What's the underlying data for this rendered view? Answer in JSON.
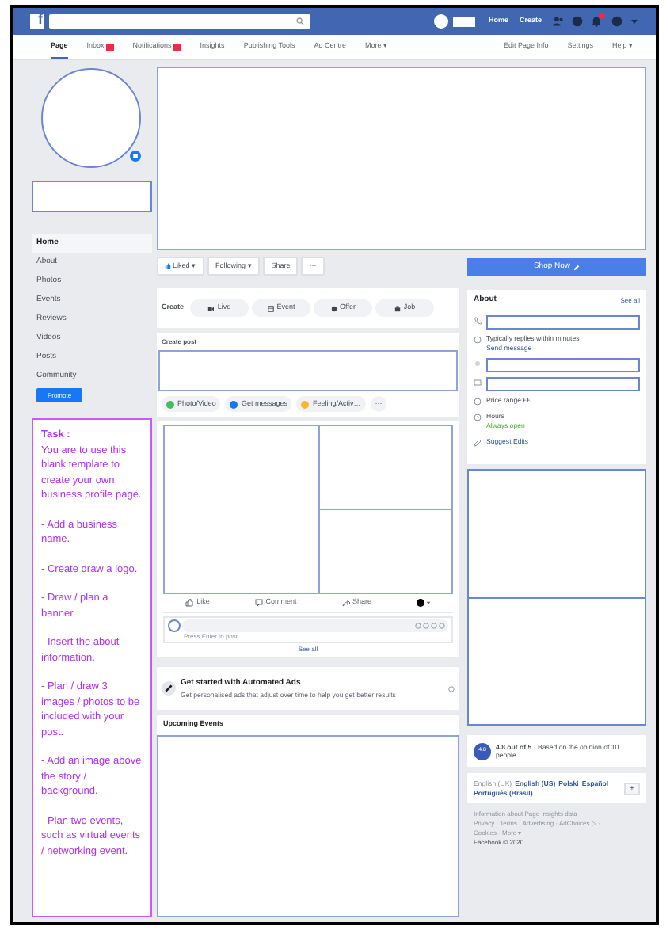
{
  "topbar": {
    "logo": "f",
    "nav": [
      "Home",
      "Create"
    ]
  },
  "tabs": [
    {
      "label": "Page",
      "selected": true,
      "badge": false
    },
    {
      "label": "Inbox",
      "selected": false,
      "badge": true
    },
    {
      "label": "Notifications",
      "selected": false,
      "badge": true
    },
    {
      "label": "Insights",
      "selected": false,
      "badge": false
    },
    {
      "label": "Publishing Tools",
      "selected": false,
      "badge": false
    },
    {
      "label": "Ad Centre",
      "selected": false,
      "badge": false
    },
    {
      "label": "More ▾",
      "selected": false,
      "badge": false
    }
  ],
  "right_tabs": [
    "Edit Page Info",
    "Settings",
    "Help ▾"
  ],
  "sidebar": {
    "items": [
      {
        "label": "Home",
        "selected": true
      },
      {
        "label": "About",
        "selected": false
      },
      {
        "label": "Photos",
        "selected": false
      },
      {
        "label": "Events",
        "selected": false
      },
      {
        "label": "Reviews",
        "selected": false
      },
      {
        "label": "Videos",
        "selected": false
      },
      {
        "label": "Posts",
        "selected": false
      },
      {
        "label": "Community",
        "selected": false
      }
    ],
    "promote": "Promote"
  },
  "task": {
    "title": "Task :",
    "paragraphs": [
      "You are to use this blank template to create your own business profile page.",
      "- Add a business name.",
      "- Create  draw a logo.",
      "- Draw / plan a banner.",
      "- Insert the about information.",
      "- Plan / draw 3 images / photos to be included with your post.",
      "- Add an image above the story / background.",
      "- Plan two events, such as virtual events / networking event."
    ]
  },
  "page_actions": [
    "Liked ▾",
    "Following ▾",
    "Share",
    "···"
  ],
  "shop_button": "Shop Now",
  "create": {
    "label": "Create",
    "buttons": [
      "Live",
      "Event",
      "Offer",
      "Job"
    ]
  },
  "create_post": {
    "title": "Create post",
    "buttons": [
      "Photo/Video",
      "Get messages",
      "Feeling/Activ…",
      "···"
    ]
  },
  "post": {
    "actions": [
      "Like",
      "Comment",
      "Share"
    ],
    "hint": "Press Enter to post.",
    "see_all": "See all"
  },
  "ads": {
    "title": "Get started with Automated Ads",
    "text": "Get personalised ads that adjust over time to help you get better results"
  },
  "events": {
    "title": "Upcoming Events"
  },
  "about": {
    "title": "About",
    "see_all": "See all",
    "items": [
      {
        "kind": "field"
      },
      {
        "kind": "text",
        "text": "Typically replies within minutes",
        "link": "Send message"
      },
      {
        "kind": "field"
      },
      {
        "kind": "field"
      },
      {
        "kind": "text",
        "text": "Price range ££"
      },
      {
        "kind": "hours",
        "text": "Hours",
        "status": "Always open"
      },
      {
        "kind": "link",
        "text": "Suggest Edits"
      }
    ]
  },
  "rating": {
    "score": "4.8",
    "text": "**4.8 out of 5** · Based on the opinion of 10 people"
  },
  "languages": {
    "items": [
      {
        "label": "English (UK)",
        "selected": true
      },
      {
        "label": "English (US)",
        "selected": false
      },
      {
        "label": "Polski",
        "selected": false
      },
      {
        "label": "Español",
        "selected": false
      },
      {
        "label": "Português (Brasil)",
        "selected": false
      }
    ],
    "button": "+"
  },
  "footer": [
    "Information about Page Insights data",
    "Privacy · Terms · Advertising · AdChoices ▷ ·",
    "Cookies · More ▾",
    "Facebook © 2020"
  ]
}
